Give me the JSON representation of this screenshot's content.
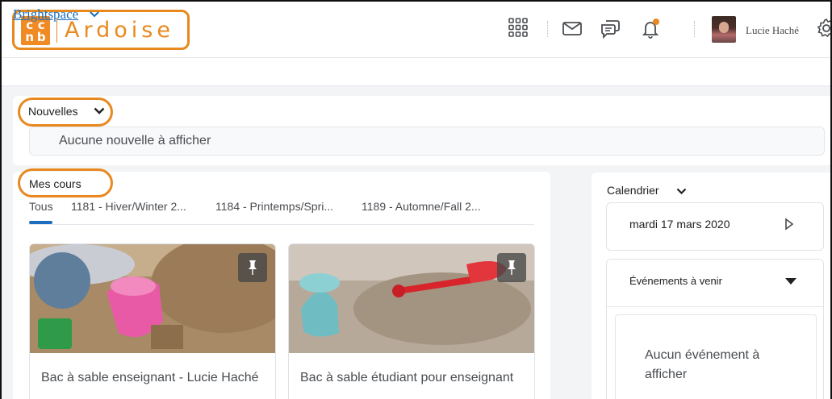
{
  "header": {
    "logo_letters": [
      "c",
      "c",
      "n",
      "b"
    ],
    "app_name": "Ardoise",
    "user_name": "Lucie Haché",
    "icons": [
      "grid-icon",
      "mail-icon",
      "chat-icon",
      "bell-icon",
      "gear-icon"
    ],
    "notification_color": "#e8891f"
  },
  "nav": {
    "home_link": "Brightspace"
  },
  "news": {
    "title": "Nouvelles",
    "empty_text": "Aucune nouvelle à afficher"
  },
  "courses": {
    "title": "Mes cours",
    "tabs": [
      {
        "label": "Tous"
      },
      {
        "label": "1181 - Hiver/Winter 2..."
      },
      {
        "label": "1184 - Printemps/Spri..."
      },
      {
        "label": "1189 - Automne/Fall 2..."
      }
    ],
    "cards": [
      {
        "title": "Bac à sable enseignant - Lucie Haché"
      },
      {
        "title": "Bac à sable étudiant pour enseignant"
      }
    ]
  },
  "calendar": {
    "title": "Calendrier",
    "date": "mardi 17 mars 2020",
    "events_title": "Événements à venir",
    "no_events": "Aucun événement à afficher"
  },
  "colors": {
    "accent": "#e8891f",
    "link": "#1a6ebd"
  }
}
